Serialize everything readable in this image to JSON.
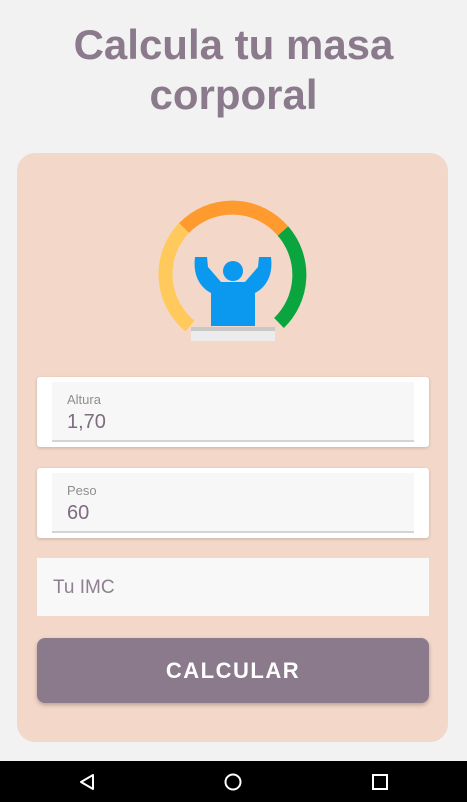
{
  "page": {
    "title": "Calcula tu masa corporal"
  },
  "form": {
    "height": {
      "label": "Altura",
      "value": "1,70"
    },
    "weight": {
      "label": "Peso",
      "value": "60"
    },
    "result": {
      "placeholder": "Tu IMC"
    },
    "calculate_label": "CALCULAR"
  },
  "icons": {
    "logo": "bmi-gauge-logo",
    "nav_back": "back-triangle-icon",
    "nav_home": "home-circle-icon",
    "nav_recents": "recents-square-icon"
  },
  "colors": {
    "accent": "#8a7a8c",
    "card_bg": "#f3d7c8",
    "gauge_yellow": "#ffca5b",
    "gauge_orange": "#ff9a2e",
    "gauge_green": "#0aa53e",
    "figure_blue": "#0b99f0"
  }
}
